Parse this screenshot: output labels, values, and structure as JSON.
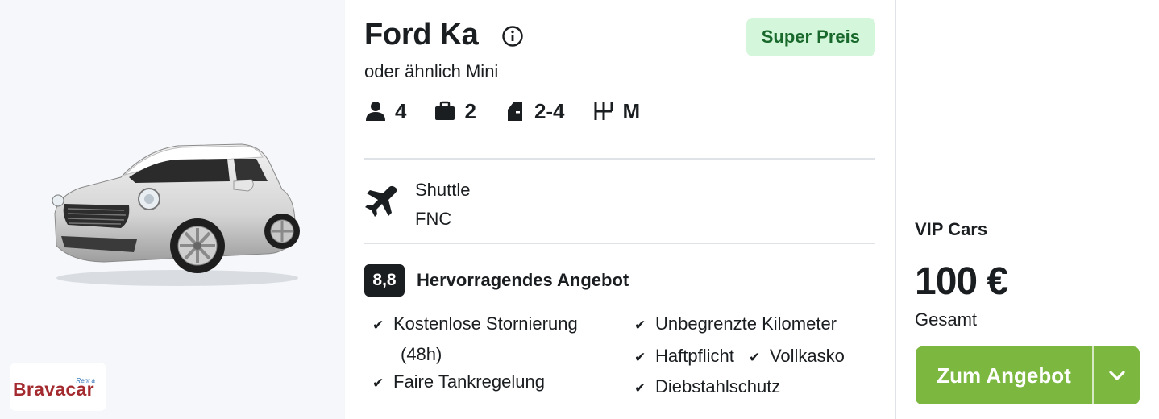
{
  "car": {
    "name": "Ford Ka",
    "similar": "oder ähnlich Mini",
    "badge": "Super Preis",
    "image_alt_icon": "car-image"
  },
  "specs": [
    {
      "icon": "person-icon",
      "value": "4"
    },
    {
      "icon": "suitcase-icon",
      "value": "2"
    },
    {
      "icon": "door-icon",
      "value": "2-4"
    },
    {
      "icon": "gearshift-icon",
      "value": "M"
    }
  ],
  "pickup": {
    "icon": "airplane-icon",
    "type": "Shuttle",
    "location": "FNC"
  },
  "rating": {
    "score": "8,8",
    "label": "Hervorragendes Angebot"
  },
  "features": {
    "left": [
      "Kostenlose Stornierung",
      "(48h)",
      "Faire Tankregelung"
    ],
    "right": [
      "Unbegrenzte Kilometer",
      "Haftpflicht",
      "Vollkasko",
      "Diebstahlschutz"
    ]
  },
  "supplier": {
    "rent": "Rent a",
    "brand": "Bravacar"
  },
  "offer": {
    "vendor": "VIP Cars",
    "price": "100 €",
    "price_label": "Gesamt",
    "cta_label": "Zum Angebot"
  },
  "colors": {
    "accent_green": "#7cb740",
    "badge_bg": "#d4f7dc",
    "badge_text": "#19692c",
    "supplier_red": "#a32a2e"
  }
}
